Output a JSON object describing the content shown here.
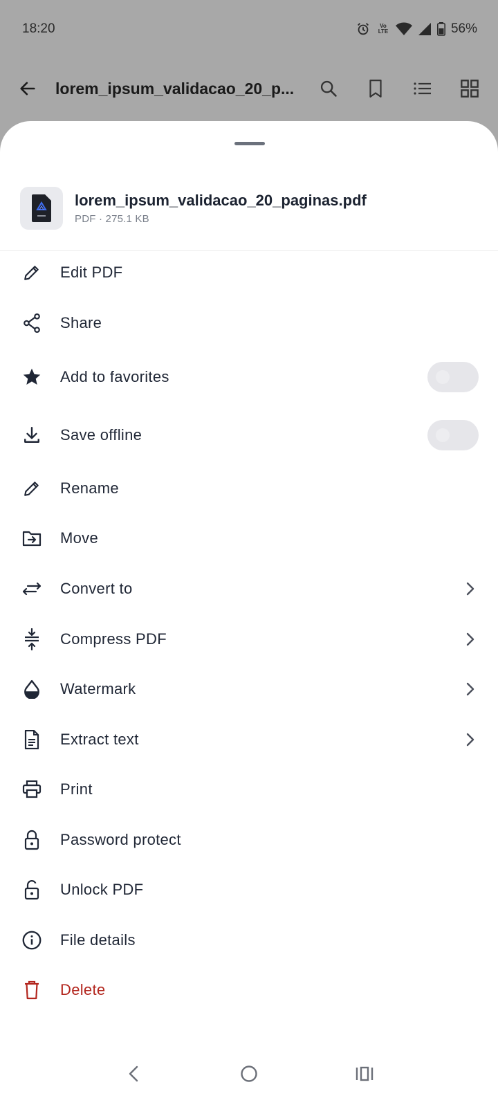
{
  "status_bar": {
    "time": "18:20",
    "lte_top": "Vo",
    "lte_bottom": "LTE",
    "battery": "56%"
  },
  "app_bar": {
    "title": "lorem_ipsum_validacao_20_p...",
    "icons": [
      "back-arrow-icon",
      "search-icon",
      "bookmark-icon",
      "list-icon",
      "grid-icon"
    ]
  },
  "file": {
    "name": "lorem_ipsum_validacao_20_paginas.pdf",
    "meta": "PDF · 275.1 KB"
  },
  "menu": [
    {
      "label": "Edit PDF",
      "icon": "pencil-icon"
    },
    {
      "label": "Share",
      "icon": "share-icon"
    },
    {
      "label": "Add to favorites",
      "icon": "star-icon",
      "toggle": false
    },
    {
      "label": "Save offline",
      "icon": "download-icon",
      "toggle": false
    },
    {
      "label": "Rename",
      "icon": "pencil-icon"
    },
    {
      "label": "Move",
      "icon": "folder-move-icon"
    },
    {
      "label": "Convert to",
      "icon": "swap-arrows-icon",
      "has_submenu": true
    },
    {
      "label": "Compress PDF",
      "icon": "compress-icon",
      "has_submenu": true
    },
    {
      "label": "Watermark",
      "icon": "drop-icon",
      "has_submenu": true
    },
    {
      "label": "Extract text",
      "icon": "document-text-icon",
      "has_submenu": true
    },
    {
      "label": "Print",
      "icon": "printer-icon"
    },
    {
      "label": "Password protect",
      "icon": "lock-icon"
    },
    {
      "label": "Unlock PDF",
      "icon": "unlock-icon"
    },
    {
      "label": "File details",
      "icon": "info-icon"
    },
    {
      "label": "Delete",
      "icon": "trash-icon",
      "danger": true
    }
  ],
  "colors": {
    "danger": "#b3261e",
    "text": "#1f2635",
    "scrim": "#a8a8a8"
  }
}
